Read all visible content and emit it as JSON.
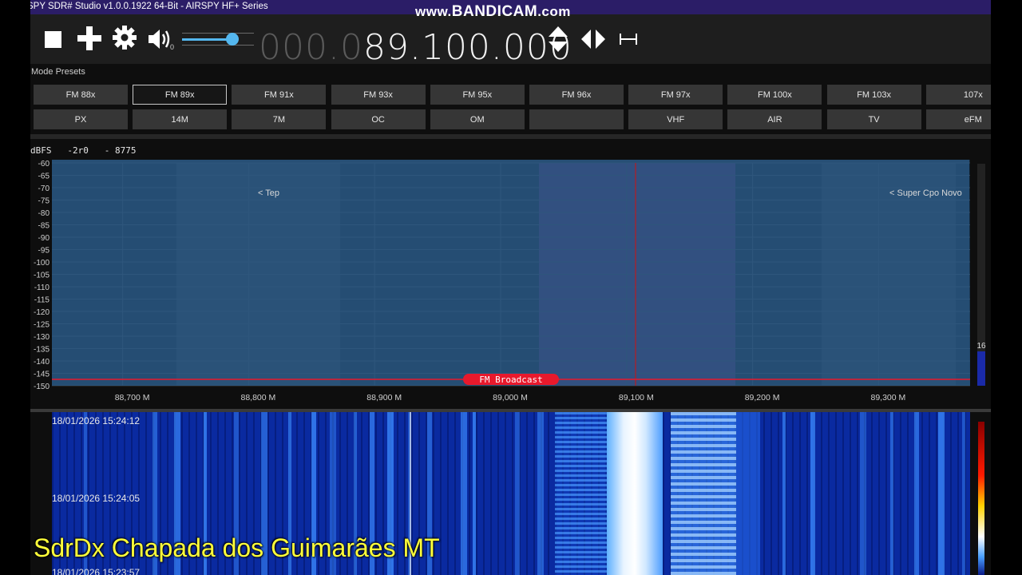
{
  "window": {
    "title": "SPY SDR# Studio v1.0.0.1922 64-Bit - AIRSPY HF+ Series"
  },
  "watermark": {
    "prefix": "www.",
    "brand": "BANDICAM",
    "suffix": ".com"
  },
  "toolbar": {
    "volume_value": "0",
    "volume_level": 0.7,
    "frequency_dim": "000.0",
    "frequency_bright": "89.100.000"
  },
  "presets": {
    "label": "Mode Presets",
    "row1": [
      "FM 88x",
      "FM 89x",
      "FM 91x",
      "FM 93x",
      "FM 95x",
      "FM 96x",
      "FM 97x",
      "FM 100x",
      "FM 103x",
      "107x"
    ],
    "row2": [
      "PX",
      "14M",
      "7M",
      "OC",
      "OM",
      "",
      "VHF",
      "AIR",
      "TV",
      "eFM"
    ],
    "selected": "FM 89x"
  },
  "spectrum": {
    "unit": "dBFS",
    "stats": "-2r0   - 8775",
    "y_ticks": [
      "-60",
      "-65",
      "-70",
      "-75",
      "-80",
      "-85",
      "-90",
      "-95",
      "-100",
      "-105",
      "-110",
      "-115",
      "-120",
      "-125",
      "-130",
      "-135",
      "-140",
      "-145",
      "-150"
    ],
    "x_ticks": [
      "88,700 M",
      "88,800 M",
      "88,900 M",
      "89,000 M",
      "89,100 M",
      "89,200 M",
      "89,300 M"
    ],
    "bookmark_left": "< Tep",
    "bookmark_right": "< Super Cpo Novo",
    "band_label": "FM Broadcast",
    "side_level": "16",
    "colors": {
      "filter": "#7a1f7a",
      "trace_fill": "#2c5a87",
      "band": "#e8192c",
      "cursor": "#d01010"
    }
  },
  "waterfall": {
    "timestamps": [
      "18/01/2026 15:24:12",
      "18/01/2026 15:24:05",
      "18/01/2026 15:23:57"
    ]
  },
  "overlay_text": "SdrDx Chapada dos Guimarães MT"
}
